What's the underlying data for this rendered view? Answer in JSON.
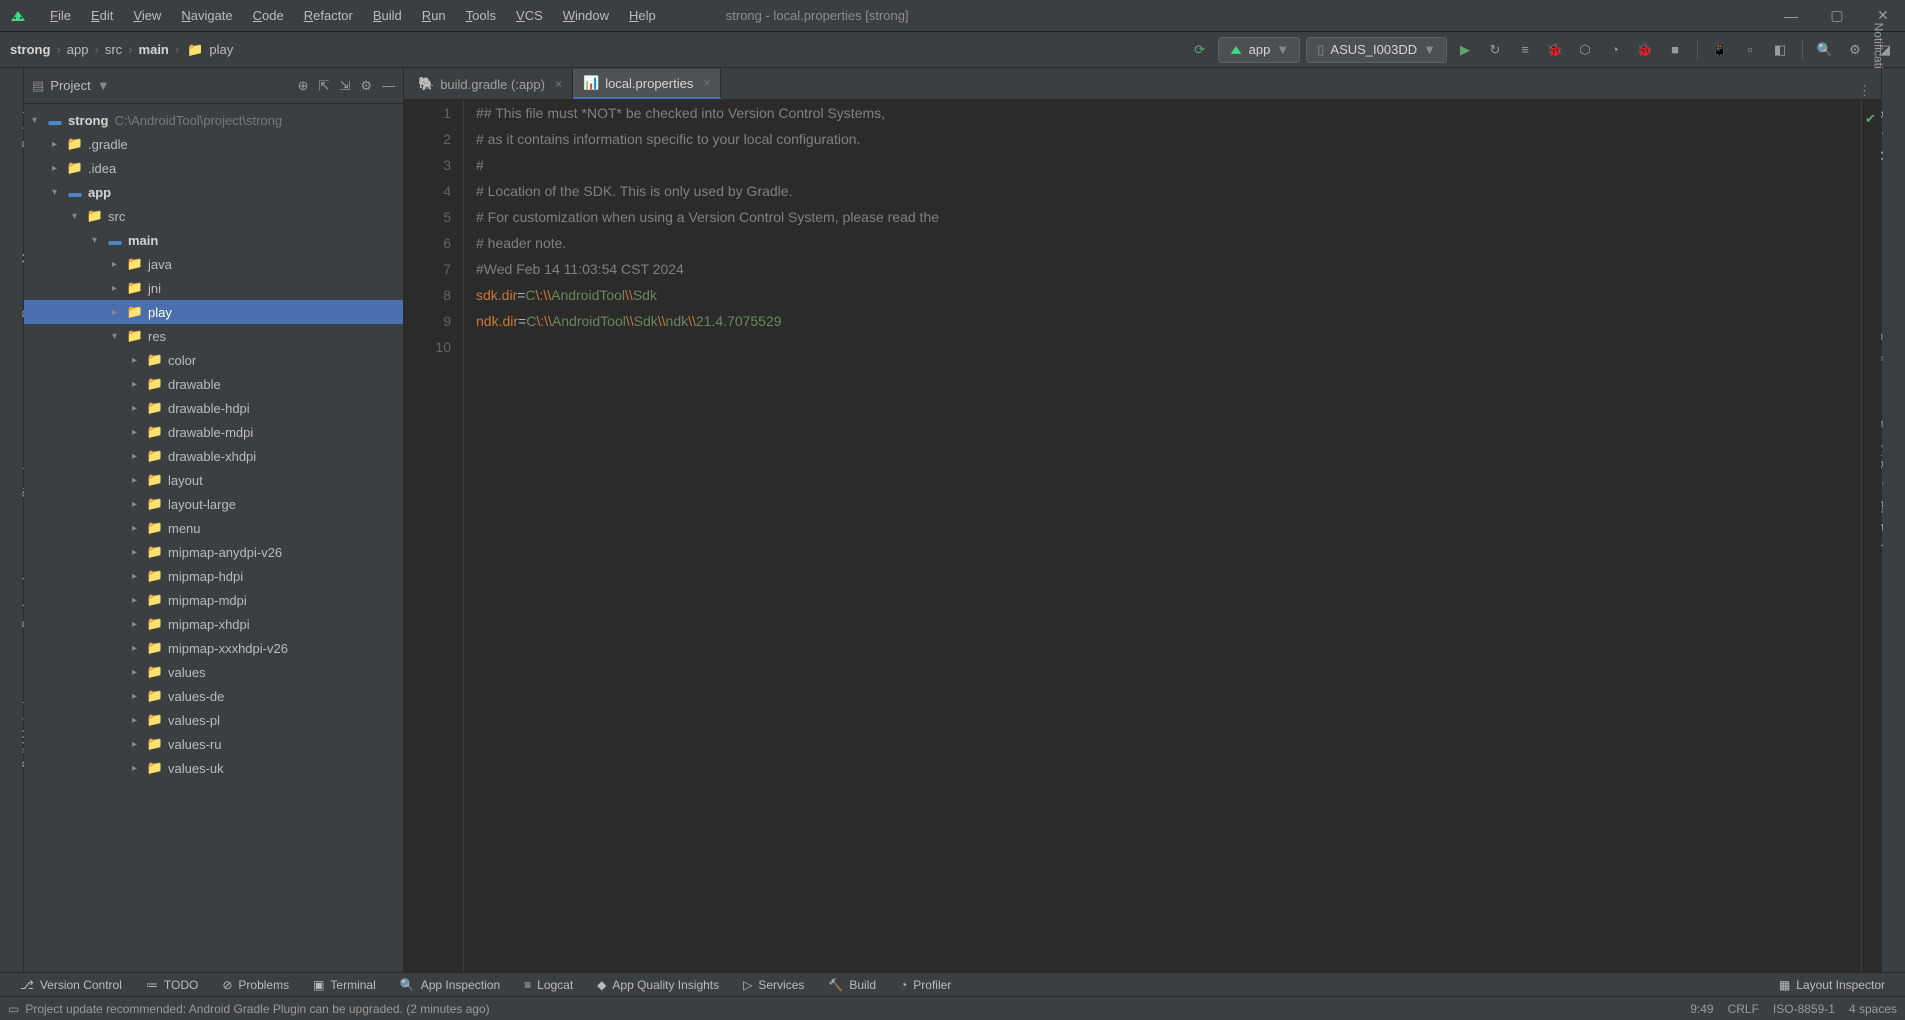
{
  "window": {
    "title": "strong - local.properties [strong]"
  },
  "menu": [
    "File",
    "Edit",
    "View",
    "Navigate",
    "Code",
    "Refactor",
    "Build",
    "Run",
    "Tools",
    "VCS",
    "Window",
    "Help"
  ],
  "breadcrumb": [
    "strong",
    "app",
    "src",
    "main",
    "play"
  ],
  "breadcrumb_bold": [
    0,
    3
  ],
  "toolbar": {
    "config": "app",
    "device": "ASUS_I003DD"
  },
  "project_panel": {
    "label": "Project"
  },
  "tree": [
    {
      "depth": 0,
      "arrow": "▾",
      "icon": "module",
      "label": "strong",
      "bold": true,
      "hint": "C:\\AndroidTool\\project\\strong"
    },
    {
      "depth": 1,
      "arrow": "▸",
      "icon": "folder-o",
      "label": ".gradle"
    },
    {
      "depth": 1,
      "arrow": "▸",
      "icon": "folder-o",
      "label": ".idea"
    },
    {
      "depth": 1,
      "arrow": "▾",
      "icon": "module",
      "label": "app",
      "bold": true
    },
    {
      "depth": 2,
      "arrow": "▾",
      "icon": "folder",
      "label": "src"
    },
    {
      "depth": 3,
      "arrow": "▾",
      "icon": "module",
      "label": "main",
      "bold": true
    },
    {
      "depth": 4,
      "arrow": "▸",
      "icon": "folder",
      "label": "java"
    },
    {
      "depth": 4,
      "arrow": "▸",
      "icon": "folder",
      "label": "jni"
    },
    {
      "depth": 4,
      "arrow": "▸",
      "icon": "folder",
      "label": "play",
      "selected": true
    },
    {
      "depth": 4,
      "arrow": "▾",
      "icon": "folder",
      "label": "res"
    },
    {
      "depth": 5,
      "arrow": "▸",
      "icon": "folder",
      "label": "color"
    },
    {
      "depth": 5,
      "arrow": "▸",
      "icon": "folder",
      "label": "drawable"
    },
    {
      "depth": 5,
      "arrow": "▸",
      "icon": "folder",
      "label": "drawable-hdpi"
    },
    {
      "depth": 5,
      "arrow": "▸",
      "icon": "folder",
      "label": "drawable-mdpi"
    },
    {
      "depth": 5,
      "arrow": "▸",
      "icon": "folder",
      "label": "drawable-xhdpi"
    },
    {
      "depth": 5,
      "arrow": "▸",
      "icon": "folder",
      "label": "layout"
    },
    {
      "depth": 5,
      "arrow": "▸",
      "icon": "folder",
      "label": "layout-large"
    },
    {
      "depth": 5,
      "arrow": "▸",
      "icon": "folder",
      "label": "menu"
    },
    {
      "depth": 5,
      "arrow": "▸",
      "icon": "folder",
      "label": "mipmap-anydpi-v26"
    },
    {
      "depth": 5,
      "arrow": "▸",
      "icon": "folder",
      "label": "mipmap-hdpi"
    },
    {
      "depth": 5,
      "arrow": "▸",
      "icon": "folder",
      "label": "mipmap-mdpi"
    },
    {
      "depth": 5,
      "arrow": "▸",
      "icon": "folder",
      "label": "mipmap-xhdpi"
    },
    {
      "depth": 5,
      "arrow": "▸",
      "icon": "folder",
      "label": "mipmap-xxxhdpi-v26"
    },
    {
      "depth": 5,
      "arrow": "▸",
      "icon": "folder",
      "label": "values"
    },
    {
      "depth": 5,
      "arrow": "▸",
      "icon": "folder",
      "label": "values-de"
    },
    {
      "depth": 5,
      "arrow": "▸",
      "icon": "folder",
      "label": "values-pl"
    },
    {
      "depth": 5,
      "arrow": "▸",
      "icon": "folder",
      "label": "values-ru"
    },
    {
      "depth": 5,
      "arrow": "▸",
      "icon": "folder",
      "label": "values-uk"
    }
  ],
  "tabs": [
    {
      "label": "build.gradle (:app)",
      "active": false,
      "icon": "gradle"
    },
    {
      "label": "local.properties",
      "active": true,
      "icon": "props"
    }
  ],
  "editor": {
    "lines": [
      {
        "n": 1,
        "segs": [
          {
            "t": "## This file must *NOT* be checked into Version Control Systems,",
            "c": "comment"
          }
        ]
      },
      {
        "n": 2,
        "segs": [
          {
            "t": "# as it contains information specific to your local configuration.",
            "c": "comment"
          }
        ]
      },
      {
        "n": 3,
        "segs": [
          {
            "t": "#",
            "c": "comment"
          }
        ]
      },
      {
        "n": 4,
        "segs": [
          {
            "t": "# Location of the SDK. This is only used by Gradle.",
            "c": "comment"
          }
        ]
      },
      {
        "n": 5,
        "segs": [
          {
            "t": "# For customization when using a Version Control System, please read the",
            "c": "comment"
          }
        ]
      },
      {
        "n": 6,
        "segs": [
          {
            "t": "# header note.",
            "c": "comment"
          }
        ]
      },
      {
        "n": 7,
        "segs": [
          {
            "t": "#Wed Feb 14 11:03:54 CST 2024",
            "c": "comment"
          }
        ]
      },
      {
        "n": 8,
        "segs": [
          {
            "t": "sdk.dir",
            "c": "key"
          },
          {
            "t": "=",
            "c": "eq"
          },
          {
            "t": "C",
            "c": "val"
          },
          {
            "t": "\\:\\\\",
            "c": "esc"
          },
          {
            "t": "AndroidTool",
            "c": "val"
          },
          {
            "t": "\\\\",
            "c": "esc"
          },
          {
            "t": "Sdk",
            "c": "val"
          }
        ]
      },
      {
        "n": 9,
        "segs": [
          {
            "t": "ndk.dir",
            "c": "key"
          },
          {
            "t": "=",
            "c": "eq"
          },
          {
            "t": "C",
            "c": "val"
          },
          {
            "t": "\\:\\\\",
            "c": "esc"
          },
          {
            "t": "AndroidTool",
            "c": "val"
          },
          {
            "t": "\\\\",
            "c": "esc"
          },
          {
            "t": "Sdk",
            "c": "val"
          },
          {
            "t": "\\\\",
            "c": "esc"
          },
          {
            "t": "ndk",
            "c": "val"
          },
          {
            "t": "\\\\",
            "c": "esc"
          },
          {
            "t": "21.4.7075529",
            "c": "val"
          }
        ]
      },
      {
        "n": 10,
        "segs": []
      }
    ]
  },
  "left_tabs": [
    "Project",
    "Resource Manager",
    "Structure",
    "Bookmarks",
    "Build Variants"
  ],
  "right_tabs": [
    "Notifications",
    "Device Manager",
    "Gradle",
    "Emulator",
    "Device File Explorer"
  ],
  "bottom_tabs": [
    "Version Control",
    "TODO",
    "Problems",
    "Terminal",
    "App Inspection",
    "Logcat",
    "App Quality Insights",
    "Services",
    "Build",
    "Profiler"
  ],
  "bottom_right": "Layout Inspector",
  "status": {
    "message": "Project update recommended: Android Gradle Plugin can be upgraded. (2 minutes ago)",
    "cursor": "9:49",
    "line_sep": "CRLF",
    "encoding": "ISO-8859-1",
    "indent": "4 spaces"
  }
}
